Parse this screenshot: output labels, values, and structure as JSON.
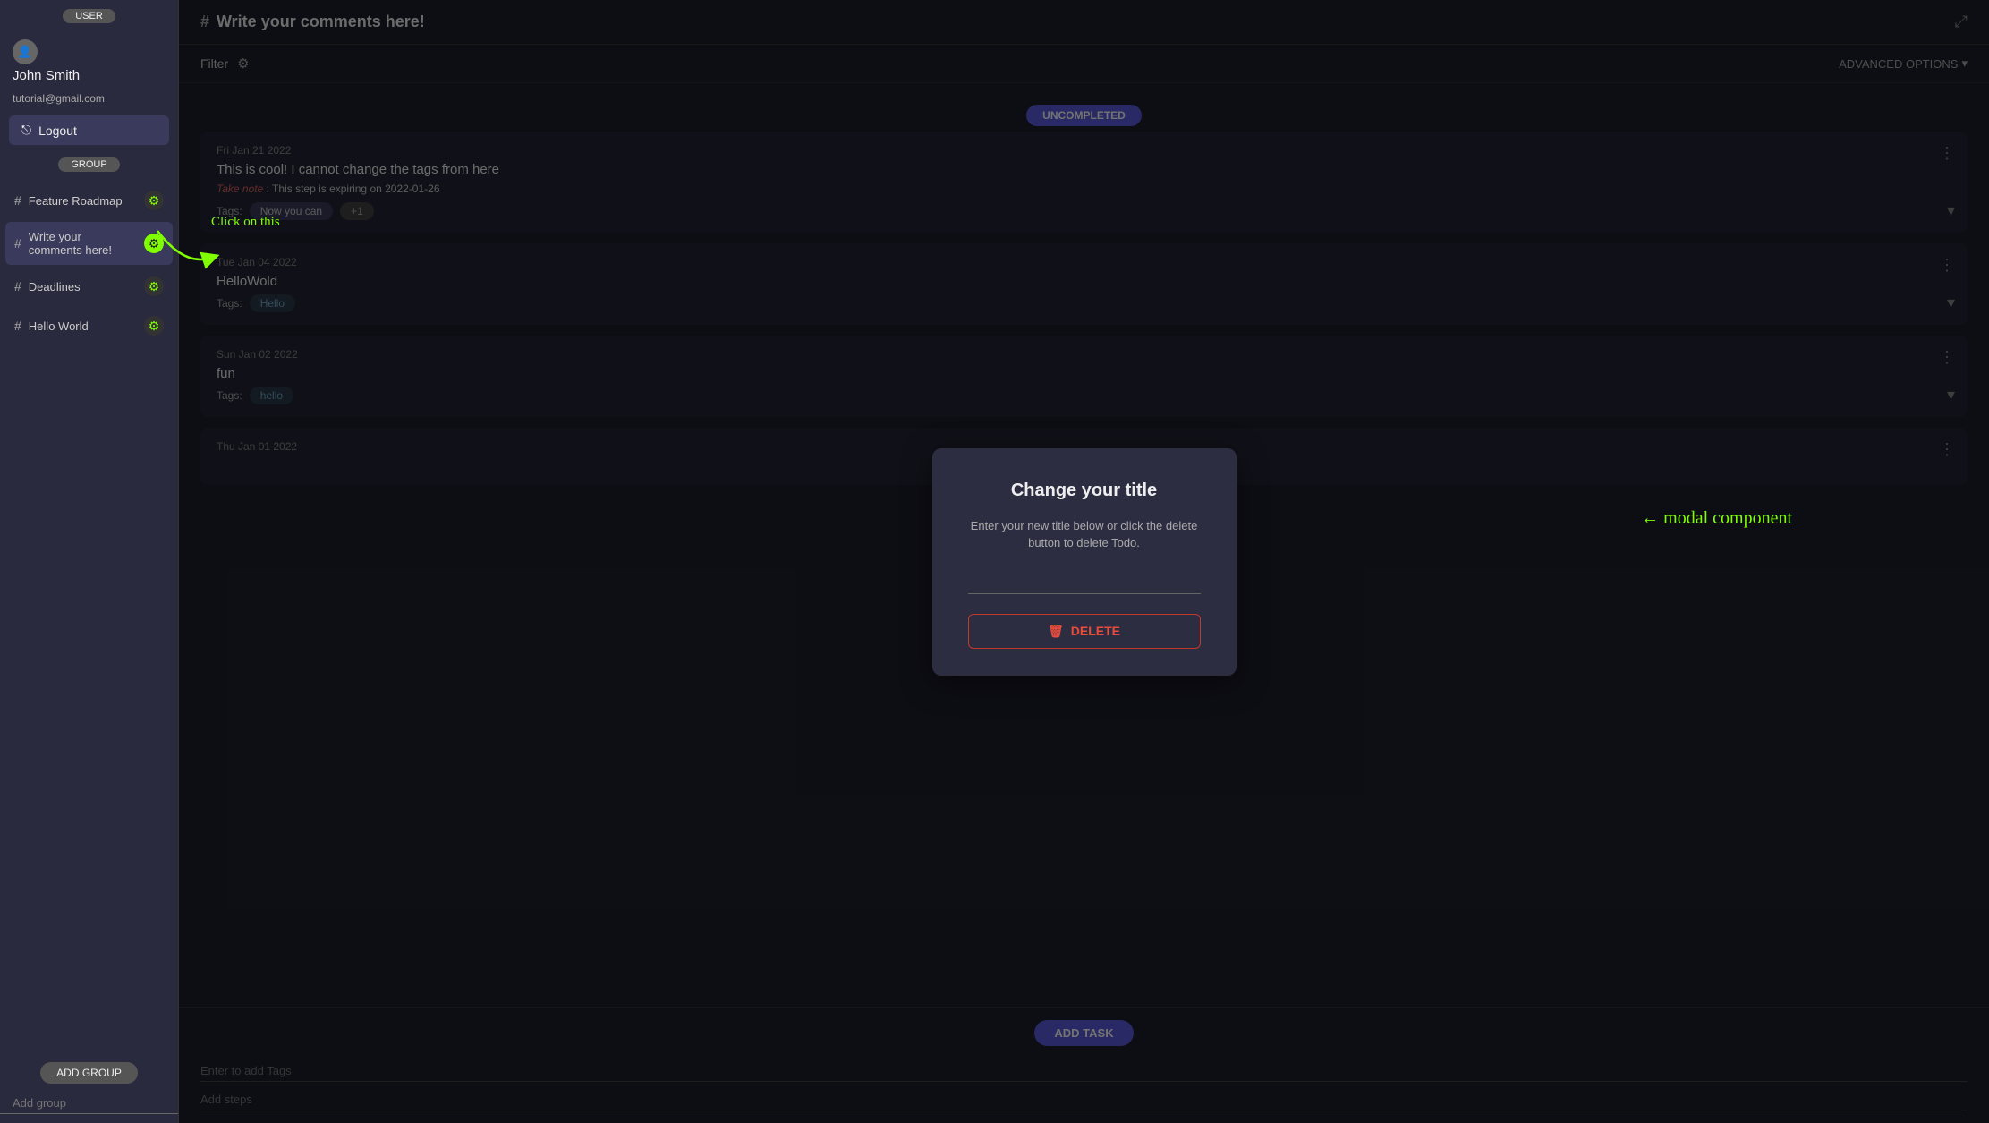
{
  "sidebar": {
    "user_badge": "USER",
    "username": "John Smith",
    "email": "tutorial@gmail.com",
    "logout_label": "Logout",
    "group_badge": "GROUP",
    "groups": [
      {
        "id": "feature-roadmap",
        "name": "Feature Roadmap",
        "has_gear": true
      },
      {
        "id": "write-comments",
        "name": "Write your comments here!",
        "has_gear": true,
        "active": true
      },
      {
        "id": "deadlines",
        "name": "Deadlines",
        "has_gear": true
      },
      {
        "id": "hello-world",
        "name": "Hello World",
        "has_gear": true
      }
    ],
    "add_group_btn": "ADD GROUP",
    "add_group_placeholder": "Add group"
  },
  "header": {
    "title": "Write your comments here!",
    "hash": "#"
  },
  "filter": {
    "label": "Filter",
    "advanced_options": "ADVANCED OPTIONS"
  },
  "uncompleted_badge": "UNCOMPLETED",
  "tasks": [
    {
      "id": "task1",
      "date": "Fri Jan 21 2022",
      "title": "This is cool! I cannot change the tags from here",
      "expiry_label": "Take note",
      "expiry_text": ": This step is expiring on 2022-01-26",
      "tags": [
        "Now you can"
      ],
      "extra_tag": "+1"
    },
    {
      "id": "task2",
      "date": "Tue Jan 04 2022",
      "title": "HelloWold",
      "tags": [
        "Hello"
      ]
    },
    {
      "id": "task3",
      "date": "Sun Jan 02 2022",
      "title": "fun",
      "tags": [
        "hello"
      ]
    },
    {
      "id": "task4",
      "date": "Thu Jan 01 2022",
      "title": ""
    }
  ],
  "bottom": {
    "add_task_btn": "ADD TASK",
    "add_tags_placeholder": "Enter to add Tags",
    "add_steps_placeholder": "Add steps"
  },
  "modal": {
    "title": "Change your title",
    "description": "Enter your new title below or click the delete button to delete Todo.",
    "input_placeholder": "",
    "delete_btn": "DELETE"
  },
  "annotations": {
    "click_on_this": "Click on this",
    "modal_component": "← modal component"
  }
}
